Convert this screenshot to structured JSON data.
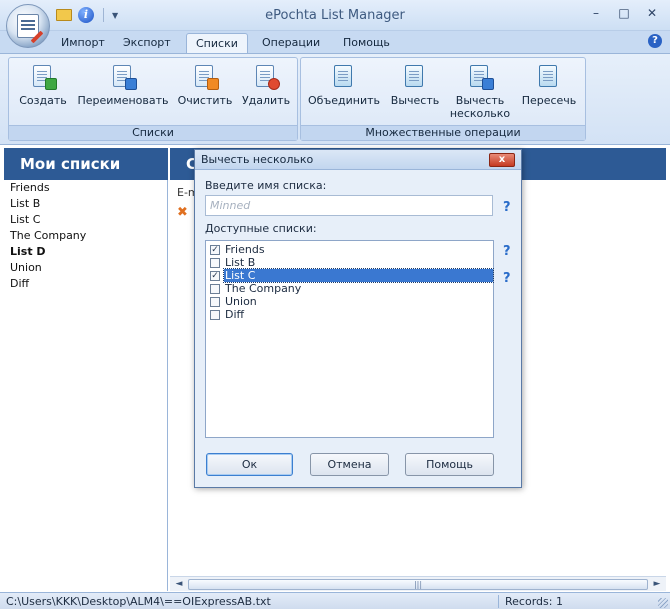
{
  "app": {
    "title": "ePochta List Manager"
  },
  "window_controls": {
    "minimize": "–",
    "maximize": "□",
    "close": "✕"
  },
  "menu": {
    "tabs": [
      {
        "label": "Импорт"
      },
      {
        "label": "Экспорт"
      },
      {
        "label": "Списки",
        "active": true
      },
      {
        "label": "Операции"
      },
      {
        "label": "Помощь"
      }
    ]
  },
  "ribbon": {
    "groups": [
      {
        "label": "Списки",
        "buttons": [
          {
            "label": "Создать",
            "icon": "list-add-icon"
          },
          {
            "label": "Переименовать",
            "icon": "list-rename-icon"
          },
          {
            "label": "Очистить",
            "icon": "list-clear-icon"
          },
          {
            "label": "Удалить",
            "icon": "list-delete-icon"
          }
        ]
      },
      {
        "label": "Множественные операции",
        "buttons": [
          {
            "label": "Объединить",
            "icon": "list-merge-icon"
          },
          {
            "label": "Вычесть",
            "icon": "list-subtract-icon"
          },
          {
            "label_line1": "Вычесть",
            "label_line2": "несколько",
            "icon": "list-subtract-multiple-icon"
          },
          {
            "label": "Пересечь",
            "icon": "list-intersect-icon"
          }
        ]
      }
    ]
  },
  "left_panel": {
    "title": "Мои списки",
    "items": [
      {
        "label": "Friends"
      },
      {
        "label": "List B"
      },
      {
        "label": "List C"
      },
      {
        "label": "The Company"
      },
      {
        "label": "List D",
        "bold": true
      },
      {
        "label": "Union"
      },
      {
        "label": "Diff"
      }
    ]
  },
  "right_panel": {
    "title": "C",
    "column_hint": "E-m"
  },
  "scrollbar": {
    "left_arrow": "◄",
    "right_arrow": "►",
    "grip": "|||"
  },
  "status": {
    "path": "C:\\Users\\KKK\\Desktop\\ALM4\\==OIExpressAB.txt",
    "records": "Records: 1"
  },
  "dialog": {
    "title": "Вычесть несколько",
    "close": "x",
    "name_label": "Введите имя списка:",
    "name_placeholder": "Minned",
    "name_value": "",
    "lists_label": "Доступные списки:",
    "help_mark": "?",
    "items": [
      {
        "label": "Friends",
        "checked": true,
        "selected": false
      },
      {
        "label": "List B",
        "checked": false,
        "selected": false
      },
      {
        "label": "List C",
        "checked": true,
        "selected": true
      },
      {
        "label": "The Company",
        "checked": false,
        "selected": false
      },
      {
        "label": "Union",
        "checked": false,
        "selected": false
      },
      {
        "label": "Diff",
        "checked": false,
        "selected": false
      }
    ],
    "ok": "Ок",
    "cancel": "Отмена",
    "help": "Помощь"
  }
}
